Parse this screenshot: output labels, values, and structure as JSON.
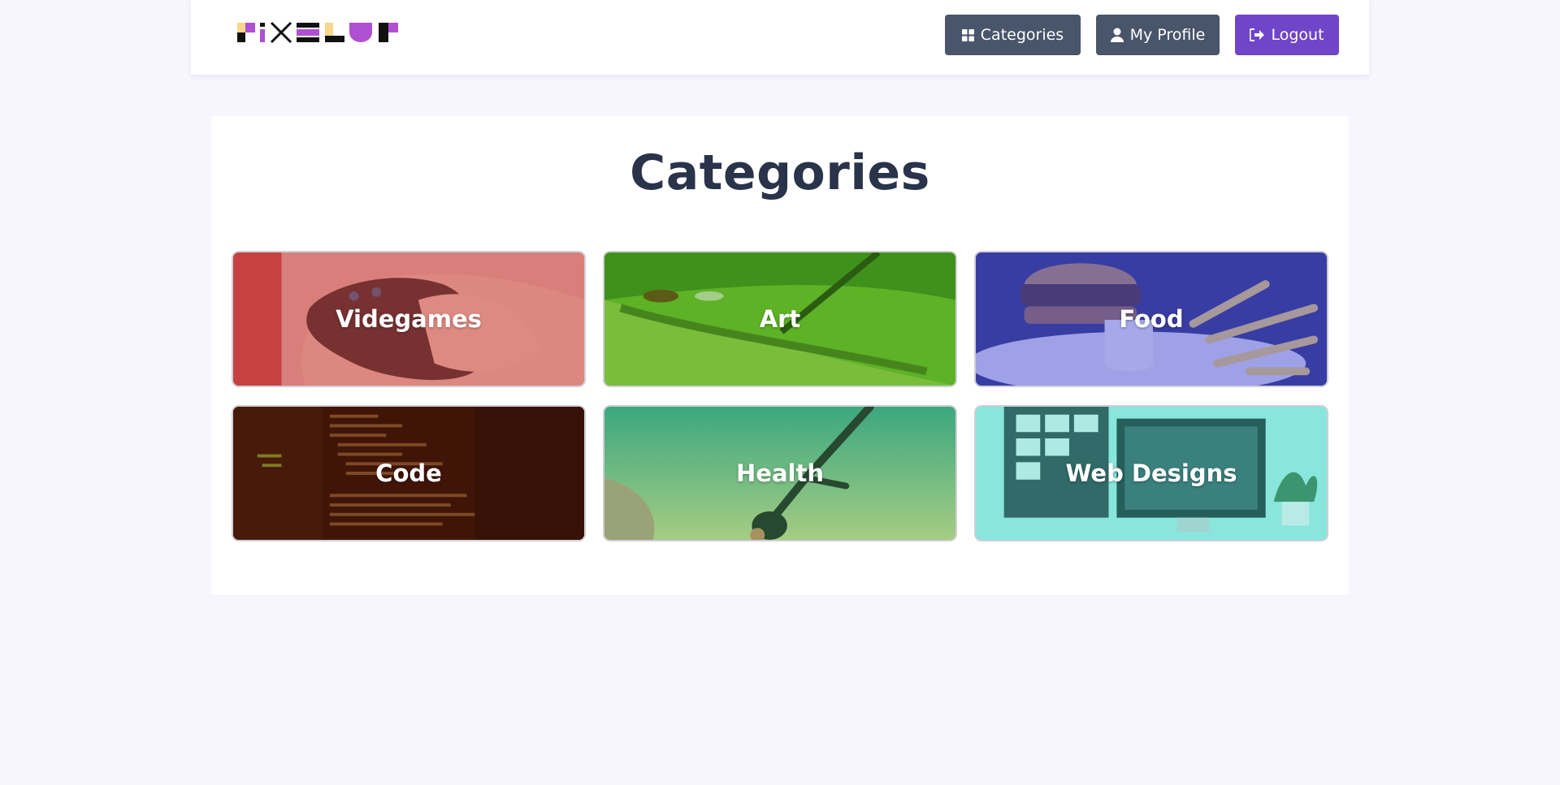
{
  "nav": {
    "logo_text": "PIXELUP",
    "categories_label": "Categories",
    "profile_label": "My Profile",
    "logout_label": "Logout"
  },
  "main": {
    "title": "Categories",
    "categories": [
      {
        "label": "Videgames",
        "color": "#c54b4b"
      },
      {
        "label": "Art",
        "color": "#3f9a1c"
      },
      {
        "label": "Food",
        "color": "#4a50d6"
      },
      {
        "label": "Code",
        "color": "#5c1a08"
      },
      {
        "label": "Health",
        "color": "#3fa66e"
      },
      {
        "label": "Web Designs",
        "color": "#3fd6c9"
      }
    ]
  },
  "colors": {
    "background": "#f7f5fe",
    "nav_button": "#48556a",
    "logout_button": "#7045c7",
    "title_text": "#29334a"
  }
}
